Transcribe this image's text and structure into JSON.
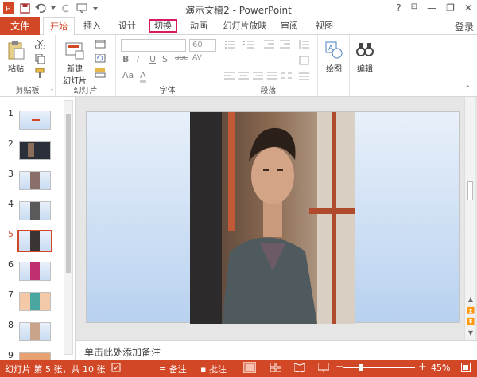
{
  "titlebar": {
    "title": "演示文稿2 - PowerPoint",
    "help": "?",
    "minimize": "—",
    "restore": "❐",
    "close": "✕"
  },
  "tabs": {
    "file": "文件",
    "items": [
      "开始",
      "插入",
      "设计",
      "切换",
      "动画",
      "幻灯片放映",
      "审阅",
      "视图"
    ],
    "active": "开始",
    "highlighted": "切换",
    "login": "登录"
  },
  "ribbon": {
    "clipboard": {
      "paste": "粘贴",
      "label": "剪贴板"
    },
    "slides": {
      "new_slide_line1": "新建",
      "new_slide_line2": "幻灯片",
      "label": "幻灯片"
    },
    "font": {
      "size_value": "60",
      "label": "字体",
      "formats": [
        "B",
        "I",
        "U",
        "S",
        "abc",
        "AV",
        "Aa",
        "A"
      ]
    },
    "paragraph": {
      "label": "段落"
    },
    "drawing": {
      "label": "绘图"
    },
    "editing": {
      "label": "编辑"
    }
  },
  "thumbnails": {
    "numbers": [
      "1",
      "2",
      "3",
      "4",
      "5",
      "6",
      "7",
      "8",
      "9"
    ],
    "selected": "5"
  },
  "notes": {
    "placeholder": "单击此处添加备注"
  },
  "status": {
    "slide_info": "幻灯片 第 5 张，共 10 张",
    "notes": "备注",
    "comments": "批注",
    "zoom_minus": "−",
    "zoom_plus": "+",
    "zoom": "45%"
  },
  "colors": {
    "accent": "#d24726",
    "highlight_box": "#d81b60"
  }
}
